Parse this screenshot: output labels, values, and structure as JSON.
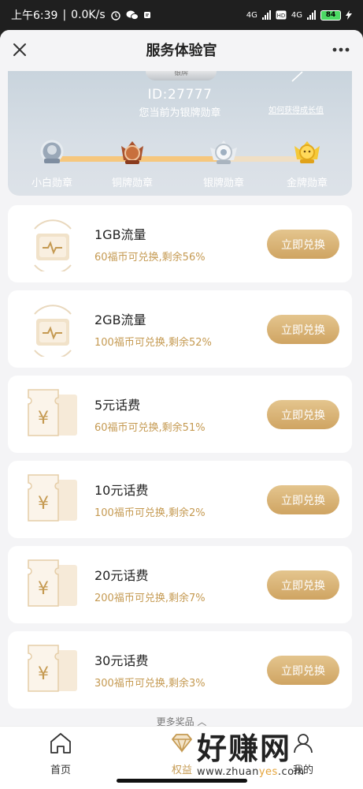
{
  "status_bar": {
    "time": "上午6:39",
    "speed": "0.0K/s",
    "net1": "4G",
    "net2": "4G",
    "battery": "84"
  },
  "nav": {
    "title": "服务体验官"
  },
  "badge_card": {
    "top_medal": "银牌",
    "id": "ID:27777",
    "current": "您当前为银牌勋章",
    "how_link": "如何获得成长值",
    "progress": 0.66,
    "medals": [
      {
        "label": "小白勋章",
        "tag": "小白",
        "color": "#8fa0b3"
      },
      {
        "label": "铜牌勋章",
        "tag": "铜牌",
        "color": "#b8643a"
      },
      {
        "label": "银牌勋章",
        "tag": "银牌",
        "color": "#c7ced6"
      },
      {
        "label": "金牌勋章",
        "tag": "金牌",
        "color": "#f3c23a"
      }
    ]
  },
  "items": [
    {
      "name": "1GB流量",
      "desc": "60福币可兑换,剩余56%",
      "button": "立即兑换",
      "icon": "data-traffic-icon"
    },
    {
      "name": "2GB流量",
      "desc": "100福币可兑换,剩余52%",
      "button": "立即兑换",
      "icon": "data-traffic-icon"
    },
    {
      "name": "5元话费",
      "desc": "60福币可兑换,剩余51%",
      "button": "立即兑换",
      "icon": "yuan-voucher-icon"
    },
    {
      "name": "10元话费",
      "desc": "100福币可兑换,剩余2%",
      "button": "立即兑换",
      "icon": "yuan-voucher-icon"
    },
    {
      "name": "20元话费",
      "desc": "200福币可兑换,剩余7%",
      "button": "立即兑换",
      "icon": "yuan-voucher-icon"
    },
    {
      "name": "30元话费",
      "desc": "300福币可兑换,剩余3%",
      "button": "立即兑换",
      "icon": "yuan-voucher-icon"
    }
  ],
  "more_prizes": "更多奖品 ︿",
  "tabs": [
    {
      "label": "首页",
      "icon": "home-icon"
    },
    {
      "label": "权益",
      "icon": "diamond-icon",
      "active": true
    },
    {
      "label": "我的",
      "icon": "profile-icon"
    }
  ],
  "watermark": {
    "big": "好赚网",
    "url_pre": "www.zhuan",
    "url_hl": "yes",
    "url_post": ".com"
  },
  "colors": {
    "accent": "#c59a52",
    "button": "#d8b274",
    "card_bg": "#ffffff",
    "page_bg": "#f4f4f6"
  }
}
